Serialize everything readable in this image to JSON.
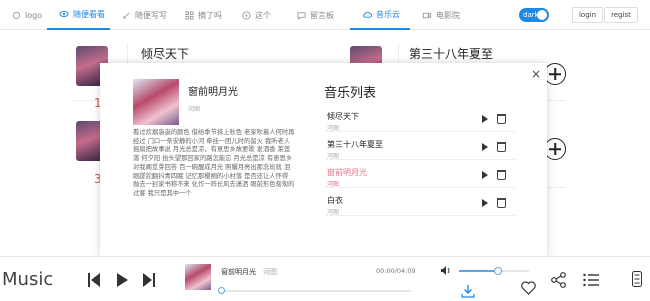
{
  "nav": {
    "items": [
      {
        "label": "logo",
        "icon": "logo-icon",
        "active": false
      },
      {
        "label": "随便看看",
        "icon": "eye-icon",
        "active": true
      },
      {
        "label": "随便写写",
        "icon": "pencil-icon",
        "active": false
      },
      {
        "label": "摘了吗",
        "icon": "grid-icon",
        "active": false
      },
      {
        "label": "这个",
        "icon": "compass-icon",
        "active": false
      },
      {
        "label": "留言板",
        "icon": "chat-icon",
        "active": false
      },
      {
        "label": "音乐云",
        "icon": "cloud-icon",
        "active": true
      },
      {
        "label": "电影院",
        "icon": "video-icon",
        "active": false
      }
    ],
    "dark_label": "dark",
    "login_label": "login",
    "register_label": "regist",
    "accent": "#1e88e5"
  },
  "background": {
    "left_card": {
      "title": "倾尽天下",
      "numbers": [
        "1",
        "3"
      ]
    },
    "right_card": {
      "title": "第三十八年夏至"
    }
  },
  "modal": {
    "song_title": "窗前明月光",
    "song_artist": "河图",
    "lyrics": "看过炊烟袅袅的颜色 借给季节抹上秋色 老家吹着人何时再经过 门口一条安静的小河 牵挂一团儿时的留火 我听老人摇扇把故事说 月光总是凉，有意思乡故要歌 发酒香 莱莲落 何夕阳 抬头望那回家的路怎能忘 月光总是凉 有意思乡对我阁觅芽回答 百一碗醒成月光 照耀月亮出那念班就 泪眼蹉跎翻抖青四眠 记忆那樱桐的小村落 是否还让人怀得 抛去一封家书称不来 化作一阵长风去潇洒 眼前形色匆匆的过客 我只是其中一个",
    "playlist_title": "音乐列表",
    "playlist": [
      {
        "title": "倾尽天下",
        "artist": "河图",
        "active": false
      },
      {
        "title": "第三十八年夏至",
        "artist": "河图",
        "active": false
      },
      {
        "title": "窗前明月光",
        "artist": "河图",
        "active": true
      },
      {
        "title": "白衣",
        "artist": "河图",
        "active": false
      }
    ],
    "active_color": "#e8708a",
    "close_symbol": "×"
  },
  "player": {
    "brand": "Music",
    "title": "窗前明月光",
    "artist": "河图",
    "time": "00:00/04:09",
    "progress": 0.0,
    "volume": 0.56,
    "accent": "#5aa6e8"
  }
}
